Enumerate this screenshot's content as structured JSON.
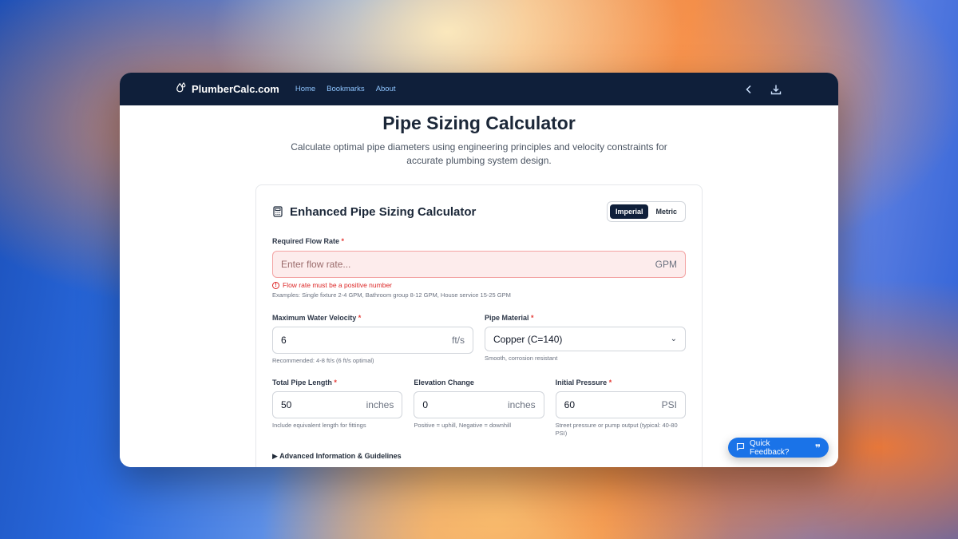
{
  "nav": {
    "brand": "PlumberCalc.com",
    "links": [
      "Home",
      "Bookmarks",
      "About"
    ]
  },
  "page": {
    "title": "Pipe Sizing Calculator",
    "subtitle": "Calculate optimal pipe diameters using engineering principles and velocity constraints for accurate plumbing system design."
  },
  "card": {
    "title": "Enhanced Pipe Sizing Calculator",
    "units": {
      "imperial": "Imperial",
      "metric": "Metric",
      "selected": "Imperial"
    }
  },
  "flow": {
    "label": "Required Flow Rate",
    "required": "*",
    "placeholder": "Enter flow rate...",
    "unit": "GPM",
    "error": "Flow rate must be a positive number",
    "help": "Examples: Single fixture 2-4 GPM, Bathroom group 8-12 GPM, House service 15-25 GPM"
  },
  "velocity": {
    "label": "Maximum Water Velocity",
    "required": "*",
    "value": "6",
    "unit": "ft/s",
    "help": "Recommended: 4-8 ft/s (6 ft/s optimal)"
  },
  "material": {
    "label": "Pipe Material",
    "required": "*",
    "value": "Copper (C=140)",
    "help": "Smooth, corrosion resistant"
  },
  "length": {
    "label": "Total Pipe Length",
    "required": "*",
    "value": "50",
    "unit": "inches",
    "help": "Include equivalent length for fittings"
  },
  "elevation": {
    "label": "Elevation Change",
    "value": "0",
    "unit": "inches",
    "help": "Positive = uphill, Negative = downhill"
  },
  "pressure": {
    "label": "Initial Pressure",
    "required": "*",
    "value": "60",
    "unit": "PSI",
    "help": "Street pressure or pump output (typical: 40-80 PSI)"
  },
  "advanced": {
    "label": "Advanced Information & Guidelines"
  },
  "feedback": {
    "label": "Quick Feedback?"
  }
}
